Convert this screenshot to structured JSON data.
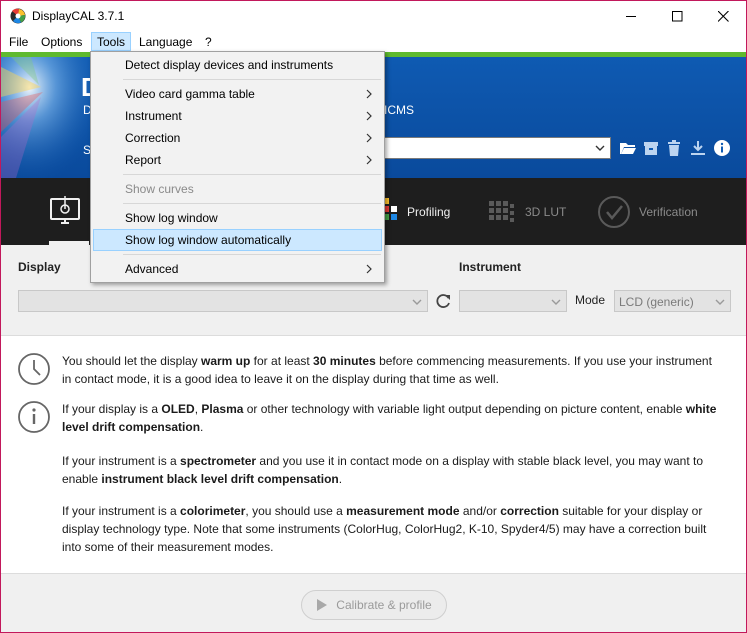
{
  "window": {
    "title": "DisplayCAL 3.7.1"
  },
  "menubar": {
    "items": [
      "File",
      "Options",
      "Tools",
      "Language",
      "?"
    ],
    "active": "Tools"
  },
  "tools_menu": {
    "items": [
      {
        "label": "Detect display devices and instruments"
      },
      {
        "label": "Video card gamma table",
        "submenu": true
      },
      {
        "label": "Instrument",
        "submenu": true
      },
      {
        "label": "Correction",
        "submenu": true
      },
      {
        "label": "Report",
        "submenu": true
      },
      {
        "label": "Show curves",
        "disabled": true
      },
      {
        "label": "Show log window"
      },
      {
        "label": "Show log window automatically",
        "highlighted": true
      },
      {
        "label": "Advanced",
        "submenu": true
      }
    ]
  },
  "banner": {
    "title_fragment": "D",
    "subtitle_fragment": "D",
    "icms_fragment": "ICMS",
    "settings_fragment": "S",
    "accent_color": "#5fba2e",
    "background_color": "#0f5bb3"
  },
  "tabs": [
    {
      "label": "Profiling",
      "icon": "profiling-icon"
    },
    {
      "label": "3D LUT",
      "icon": "cube-grid-icon"
    },
    {
      "label": "Verification",
      "icon": "checkmark-circle-icon"
    }
  ],
  "devices": {
    "display_label": "Display",
    "instrument_label": "Instrument",
    "mode_label": "Mode",
    "mode_value": "LCD (generic)"
  },
  "info": {
    "p1_a": "You should let the display ",
    "p1_b": "warm up",
    "p1_c": " for at least ",
    "p1_d": "30 minutes",
    "p1_e": " before commencing measurements. If you use your instrument in contact mode, it is a good idea to leave it on the display during that time as well.",
    "p2_a": "If your display is a ",
    "p2_b": "OLED",
    "p2_c": ", ",
    "p2_d": "Plasma",
    "p2_e": " or other technology with variable light output depending on picture content, enable ",
    "p2_f": "white level drift compensation",
    "p2_g": ".",
    "p3_a": "If your instrument is a ",
    "p3_b": "spectrometer",
    "p3_c": " and you use it in contact mode on a display with stable black level, you may want to enable ",
    "p3_d": "instrument black level drift compensation",
    "p3_e": ".",
    "p4_a": "If your instrument is a ",
    "p4_b": "colorimeter",
    "p4_c": ", you should use a ",
    "p4_d": "measurement mode",
    "p4_e": " and/or ",
    "p4_f": "correction",
    "p4_g": " suitable for your display or display technology type. Note that some instruments (ColorHug, ColorHug2, K-10, Spyder4/5) may have a correction built into some of their measurement modes."
  },
  "footer": {
    "calibrate_label": "Calibrate & profile"
  }
}
